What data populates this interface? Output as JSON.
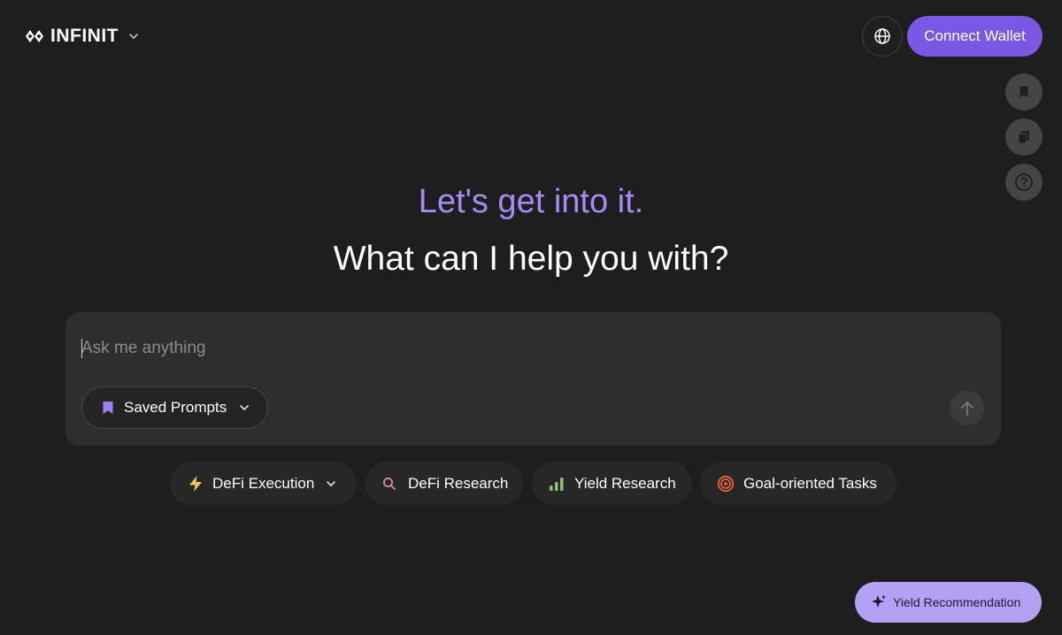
{
  "header": {
    "brand_name": "INFINIT",
    "connect_wallet_label": "Connect Wallet",
    "icons": {
      "brand": "infinit-logo-icon",
      "brand_dropdown": "chevron-down-icon",
      "language": "globe-icon"
    }
  },
  "side_tools": [
    {
      "name": "bookmark-icon"
    },
    {
      "name": "copy-icon"
    },
    {
      "name": "help-icon"
    }
  ],
  "hero": {
    "line1": "Let's get into it.",
    "line2": "What can I help you with?"
  },
  "prompt": {
    "placeholder": "Ask me anything",
    "value": "",
    "saved_prompts_label": "Saved Prompts",
    "send_icon": "arrow-up-icon"
  },
  "categories": [
    {
      "label": "DeFi Execution",
      "icon": "lightning-icon",
      "has_dropdown": true
    },
    {
      "label": "DeFi Research",
      "icon": "search-icon",
      "has_dropdown": false
    },
    {
      "label": "Yield Research",
      "icon": "bar-chart-icon",
      "has_dropdown": false
    },
    {
      "label": "Goal-oriented Tasks",
      "icon": "target-icon",
      "has_dropdown": false
    }
  ],
  "yield_recommendation": {
    "label": "Yield Recommendation",
    "icon": "sparkle-icon"
  },
  "colors": {
    "background": "#1e1e1e",
    "accent": "#7b57e6",
    "headline_accent": "#a78bf3",
    "yield_button": "#b3a1f4",
    "lightning": "#f2c94c",
    "search": "#e08ab8",
    "bar_chart": "#8fbf6a",
    "target": "#e8623c"
  }
}
